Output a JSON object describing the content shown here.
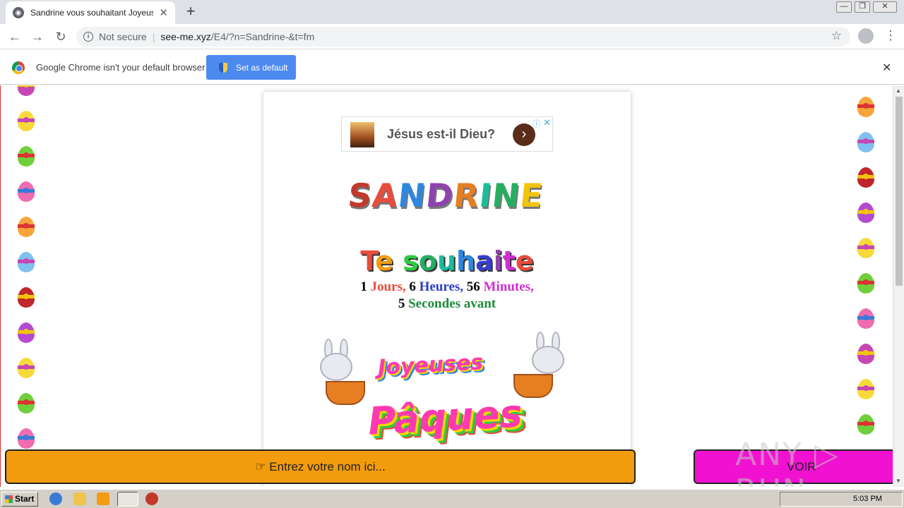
{
  "browser": {
    "tab_title": "Sandrine vous souhaitant Joyeuses Pâques",
    "tab_close": "✕",
    "new_tab": "+",
    "address": {
      "security_label": "Not secure",
      "host": "see-me.xyz",
      "path": "/E4/?n=Sandrine-&t=fm"
    },
    "window_controls": [
      "—",
      "❐",
      "✕"
    ]
  },
  "infobar": {
    "message": "Google Chrome isn't your default browser",
    "button_label": "Set as default",
    "close": "✕"
  },
  "page": {
    "ad": {
      "text": "Jésus est-il Dieu?",
      "arrow": "›",
      "info": "ⓘ",
      "close": "✕"
    },
    "name_letters": [
      "S",
      "A",
      "N",
      "D",
      "R",
      "I",
      "N",
      "E"
    ],
    "wishes": "Te souhaite",
    "countdown": {
      "days_num": "1",
      "days_label": "Jours,",
      "hours_num": "6",
      "hours_label": "Heures,",
      "minutes_num": "56",
      "minutes_label": "Minutes,",
      "seconds_num": "5",
      "seconds_label": "Secondes avant"
    },
    "greeting_line1": "Joyeuses",
    "greeting_line2": "Pâques",
    "name_prompt": "☞ Entrez votre nom ici...",
    "voir_label": "VOIR",
    "watermark": "ANY ▷ RUN"
  },
  "taskbar": {
    "start_label": "Start",
    "clock": "5:03 PM"
  }
}
